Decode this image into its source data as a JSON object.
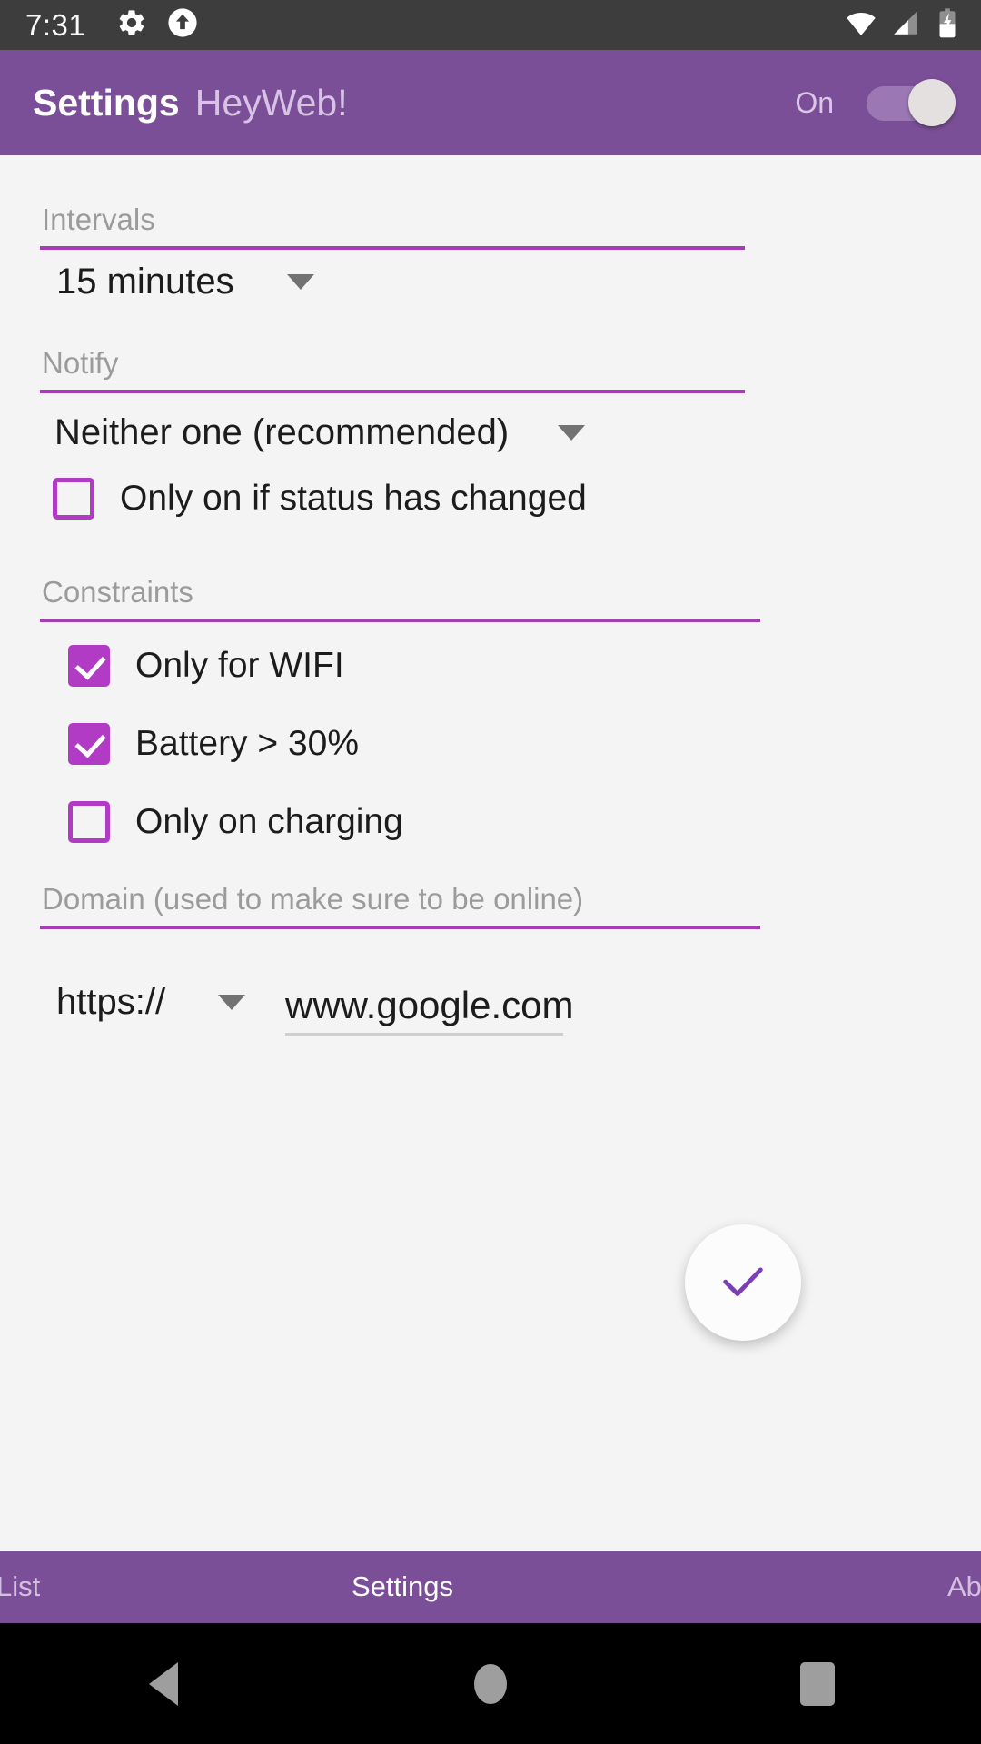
{
  "statusbar": {
    "time": "7:31",
    "icons": [
      "gear-icon",
      "upload-circle-icon"
    ],
    "right_icons": [
      "wifi-icon",
      "cellular-signal-icon",
      "battery-charging-icon"
    ]
  },
  "appbar": {
    "title": "Settings",
    "subtitle": "HeyWeb!",
    "switch_label": "On",
    "switch_on": true
  },
  "sections": {
    "intervals": {
      "label": "Intervals",
      "selected": "15 minutes"
    },
    "notify": {
      "label": "Notify",
      "selected": "Neither one (recommended)",
      "checkbox": {
        "label": "Only on if status has changed",
        "checked": false
      }
    },
    "constraints": {
      "label": "Constraints",
      "items": [
        {
          "label": "Only for WIFI",
          "checked": true
        },
        {
          "label": "Battery > 30%",
          "checked": true
        },
        {
          "label": "Only on charging",
          "checked": false
        }
      ]
    },
    "domain": {
      "label": "Domain (used to make sure to be online)",
      "scheme": "https://",
      "value": "www.google.com"
    }
  },
  "fab": {
    "icon": "check-icon"
  },
  "tabs": [
    {
      "label": "List",
      "active": false
    },
    {
      "label": "Settings",
      "active": true
    },
    {
      "label": "About",
      "active": false
    }
  ],
  "navbar": {
    "back": "back-triangle-icon",
    "home": "home-circle-icon",
    "recents": "recents-square-icon"
  },
  "colors": {
    "accent": "#a53db5",
    "primary": "#7b4f97",
    "checkbox": "#b13bc4",
    "background": "#f4f4f4",
    "statusbar": "#3d3d3d"
  }
}
